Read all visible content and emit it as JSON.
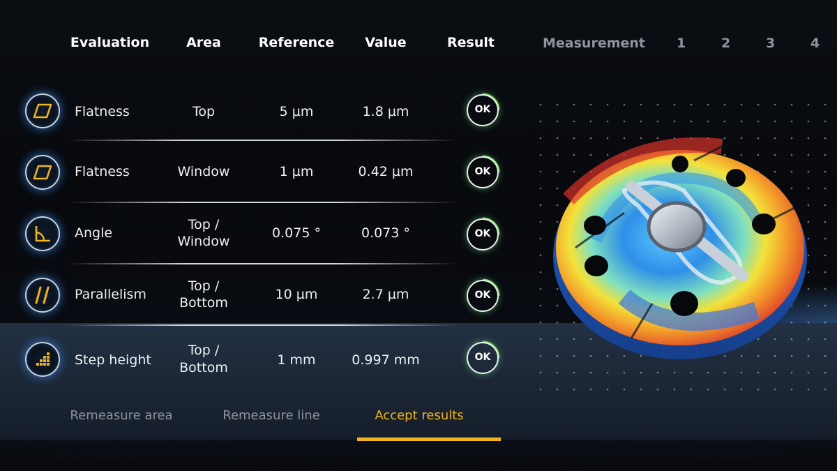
{
  "header": {
    "columns": [
      "Evaluation",
      "Area",
      "Reference",
      "Value",
      "Result"
    ],
    "measurement_label": "Measurement",
    "measurement_numbers": [
      "1",
      "2",
      "3",
      "4"
    ]
  },
  "rows": [
    {
      "icon": "flatness-parallelogram-icon",
      "evaluation": "Flatness",
      "area_line1": "Top",
      "area_line2": "",
      "reference": "5 µm",
      "value": "1.8 µm",
      "result": "OK"
    },
    {
      "icon": "flatness-parallelogram-icon",
      "evaluation": "Flatness",
      "area_line1": "Window",
      "area_line2": "",
      "reference": "1 µm",
      "value": "0.42 µm",
      "result": "OK"
    },
    {
      "icon": "angle-icon",
      "evaluation": "Angle",
      "area_line1": "Top /",
      "area_line2": "Window",
      "reference": "0.075 °",
      "value": "0.073 °",
      "result": "OK"
    },
    {
      "icon": "parallelism-icon",
      "evaluation": "Parallelism",
      "area_line1": "Top /",
      "area_line2": "Bottom",
      "reference": "10 µm",
      "value": "2.7 µm",
      "result": "OK"
    },
    {
      "icon": "step-height-icon",
      "evaluation": "Step height",
      "area_line1": "Top /",
      "area_line2": "Bottom",
      "reference": "1 mm",
      "value": "0.997 mm",
      "result": "OK"
    }
  ],
  "actions": {
    "remeasure_area": "Remeasure area",
    "remeasure_line": "Remeasure line",
    "accept_results": "Accept results",
    "active": "accept_results"
  },
  "colors": {
    "accent": "#f0b51c",
    "ok_ring": "#7ed957",
    "icon_glow": "#3c96ff"
  }
}
